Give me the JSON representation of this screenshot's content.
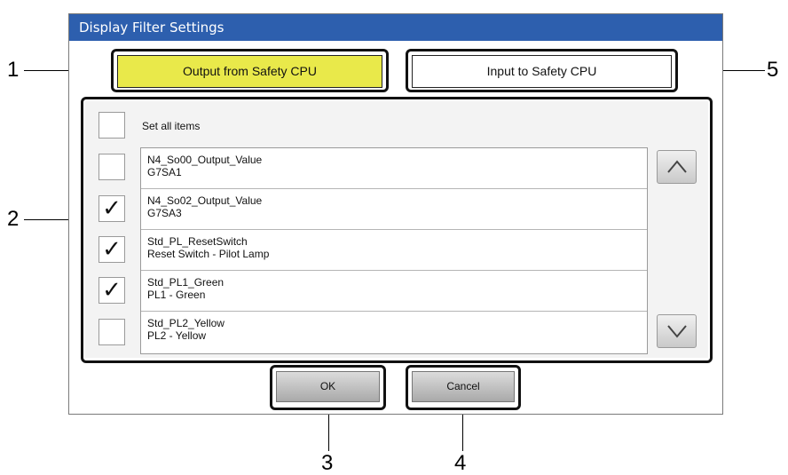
{
  "dialog": {
    "title": "Display Filter Settings"
  },
  "tabs": {
    "output_label": "Output from Safety CPU",
    "input_label": "Input to Safety CPU"
  },
  "set_all": {
    "label": "Set all items",
    "checked": false
  },
  "items": [
    {
      "name": "N4_So00_Output_Value",
      "detail": "G7SA1",
      "checked": false,
      "check_mark": ""
    },
    {
      "name": "N4_So02_Output_Value",
      "detail": "G7SA3",
      "checked": true,
      "check_mark": "✓"
    },
    {
      "name": "Std_PL_ResetSwitch",
      "detail": "Reset Switch - Pilot Lamp",
      "checked": true,
      "check_mark": "✓"
    },
    {
      "name": "Std_PL1_Green",
      "detail": "PL1 - Green",
      "checked": true,
      "check_mark": "✓"
    },
    {
      "name": "Std_PL2_Yellow",
      "detail": "PL2 - Yellow",
      "checked": false,
      "check_mark": ""
    }
  ],
  "scroll": {
    "up_icon": "chevron-up-icon",
    "down_icon": "chevron-down-icon"
  },
  "buttons": {
    "ok_label": "OK",
    "cancel_label": "Cancel"
  },
  "callouts": [
    "1",
    "2",
    "3",
    "4",
    "5"
  ],
  "colors": {
    "titlebar": "#2d5fae",
    "active_tab": "#e9e94a",
    "panel": "#f3f3f3"
  }
}
